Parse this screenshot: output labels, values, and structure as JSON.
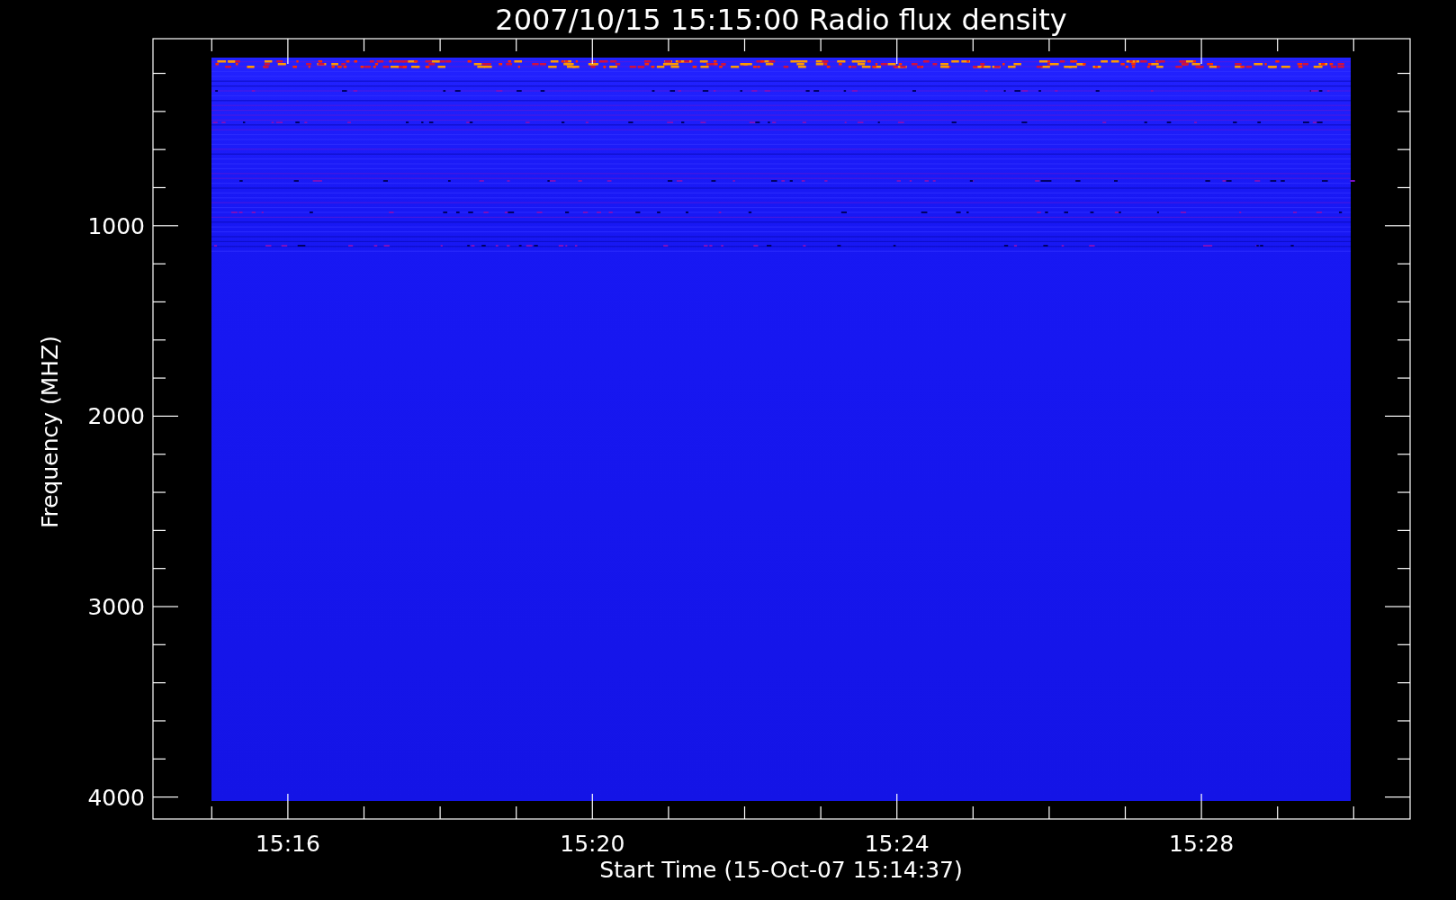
{
  "title": "2007/10/15 15:15:00 Radio flux density",
  "y_axis": {
    "label": "Frequency (MHZ)",
    "ticks": [
      "1000",
      "2000",
      "3000",
      "4000"
    ]
  },
  "x_axis": {
    "label": "Start Time (15-Oct-07 15:14:37)",
    "ticks": [
      "15:16",
      "15:20",
      "15:24",
      "15:28"
    ]
  }
}
